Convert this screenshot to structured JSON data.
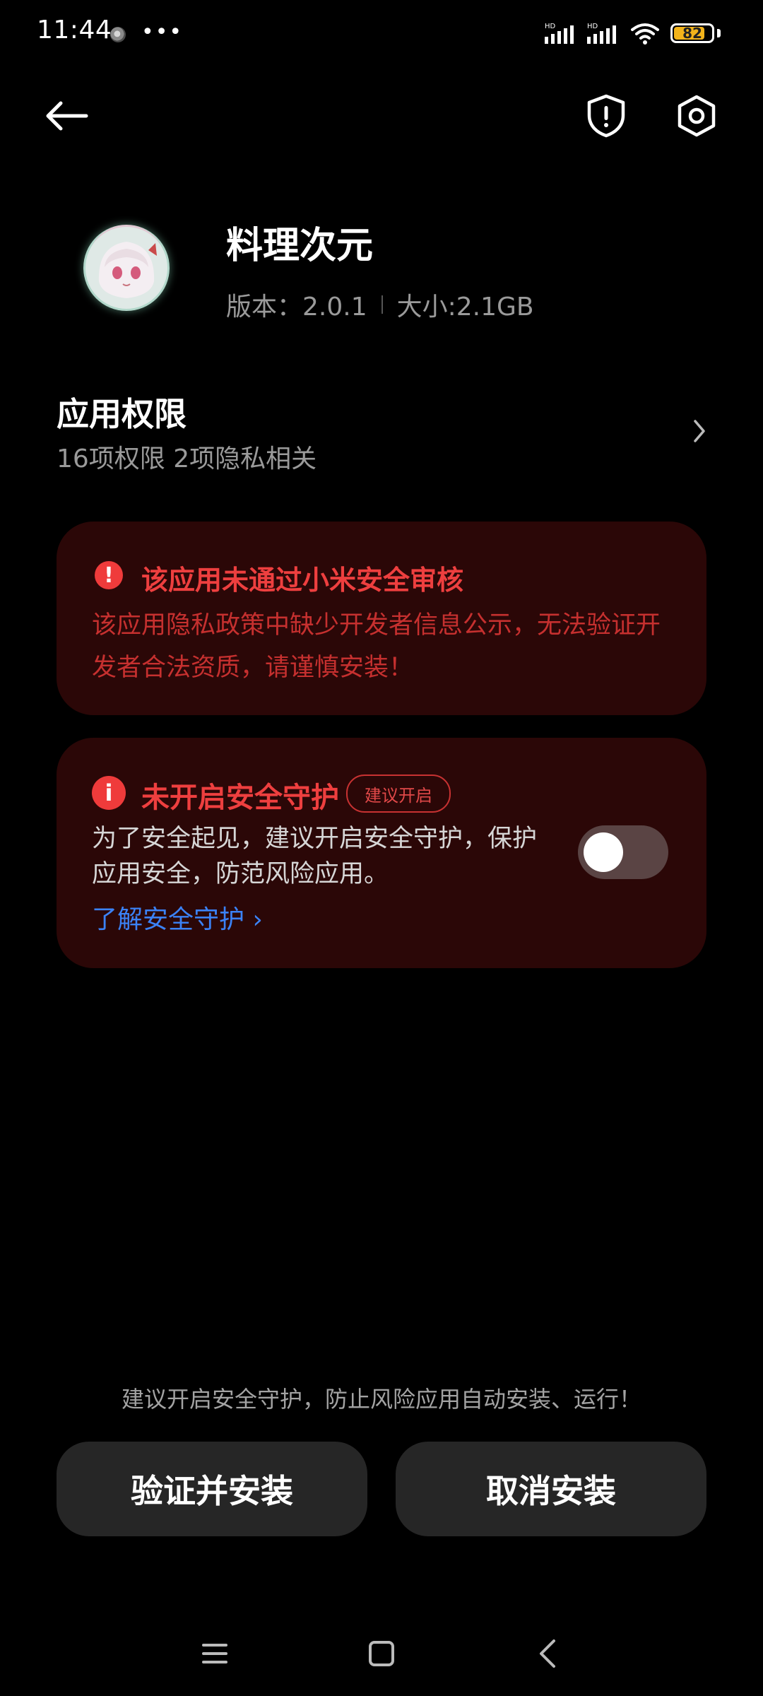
{
  "status_bar": {
    "time": "11:44",
    "more": "•••",
    "signal1_label": "HD",
    "signal2_label": "HD",
    "battery_level_percent": 82,
    "battery_text": "82"
  },
  "toolbar": {
    "back_icon": "arrow-left-icon",
    "security_icon": "shield-alert-icon",
    "settings_icon": "settings-hex-icon"
  },
  "app": {
    "name": "料理次元",
    "version": "版本：2.0.1",
    "size": "大小:2.1GB"
  },
  "permissions": {
    "title": "应用权限",
    "summary": "16项权限 2项隐私相关"
  },
  "warning_card": {
    "title": "该应用未通过小米安全审核",
    "body": "该应用隐私政策中缺少开发者信息公示，无法验证开发者合法资质，请谨慎安装！"
  },
  "protection_card": {
    "title": "未开启安全守护",
    "badge": "建议开启",
    "body": "为了安全起见，建议开启安全守护，保护应用安全，防范风险应用。",
    "link": "了解安全守护 ›",
    "toggle_on": false
  },
  "footer": {
    "note": "建议开启安全守护，防止风险应用自动安装、运行！",
    "verify_install": "验证并安装",
    "cancel_install": "取消安装"
  },
  "nav": {
    "menu_icon": "menu-icon",
    "home_icon": "home-square-icon",
    "back_icon": "chevron-left-icon"
  },
  "colors": {
    "background": "#000000",
    "card": "#2b0707",
    "warning_red": "#ee3f3f",
    "link_blue": "#3b82f6",
    "button_bg": "#262626"
  }
}
